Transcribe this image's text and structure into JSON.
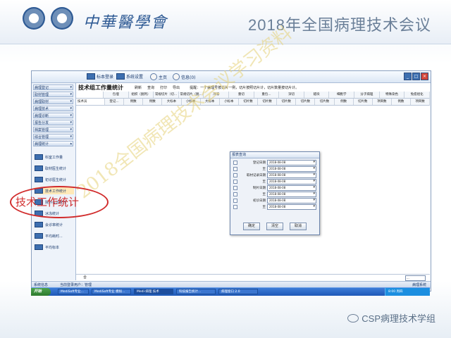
{
  "header": {
    "calligraphy": "中華醫學會",
    "conference_title": "2018年全国病理技术会议"
  },
  "toolbar": {
    "items": [
      {
        "label": "标本登录"
      },
      {
        "label": "系统设置"
      },
      {
        "label": "主页"
      },
      {
        "label": "信息(0)"
      }
    ]
  },
  "sidebar": {
    "groups": [
      {
        "label": "病理登记",
        "arrow": "▾"
      },
      {
        "label": "取材管理",
        "arrow": "▾"
      },
      {
        "label": "病理取材",
        "arrow": "▾"
      },
      {
        "label": "病理技术",
        "arrow": "▾"
      },
      {
        "label": "病理诊断",
        "arrow": "▾"
      },
      {
        "label": "报告分发",
        "arrow": "▾"
      },
      {
        "label": "档案管理",
        "arrow": "▾"
      },
      {
        "label": "综合管理",
        "arrow": "▾"
      },
      {
        "label": "病理统计",
        "arrow": "▴"
      }
    ],
    "sub_items": [
      {
        "label": "科室工作量"
      },
      {
        "label": "取材医生统计"
      },
      {
        "label": "初诊医生统计"
      },
      {
        "label": "技术工作统计"
      },
      {
        "label": "院外会诊统计"
      },
      {
        "label": "冰冻统计"
      },
      {
        "label": "会诊率统计"
      },
      {
        "label": "平均耗时..."
      },
      {
        "label": "平均标本"
      }
    ]
  },
  "main": {
    "title": "技术组工作量统计",
    "actions": [
      "刷新",
      "查询",
      "打印",
      "导出"
    ],
    "tip": "提醒：一个病理号按白片一例，切片按照切片计，切片数量按切片计。",
    "header_row1": [
      "",
      "包埋",
      "组织（脱钙）",
      "常规切片（切...",
      "常规切片（脱...",
      "冷冻",
      "重切",
      "重包...",
      "深切",
      "蜡块",
      "细胞学",
      "分子病理",
      "特殊染色",
      "免疫组化"
    ],
    "header_row2": [
      "技术员",
      "登记...",
      "例数",
      "例数",
      "大标本",
      "小标本",
      "大标本",
      "小标本",
      "切片数",
      "切片数",
      "切片数",
      "切片数",
      "切片数",
      "例数",
      "切片数",
      "项目数",
      "例数",
      "项目数"
    ],
    "bottom_label": "合",
    "bottom_control": "..."
  },
  "dialog": {
    "title": "报表查询",
    "rows": [
      {
        "label": "登记日期",
        "value": "2018-08-08"
      },
      {
        "label": "至",
        "value": "2018-08-08"
      },
      {
        "label": "取材记录日期",
        "value": "2018-08-08"
      },
      {
        "label": "至",
        "value": "2018-08-08"
      },
      {
        "label": "制片日期",
        "value": "2018-08-08"
      },
      {
        "label": "至",
        "value": "2018-08-08"
      },
      {
        "label": "初诊日期",
        "value": "2018-08-08"
      },
      {
        "label": "至",
        "value": "2018-08-08"
      }
    ],
    "buttons": {
      "ok": "确定",
      "clear": "清空",
      "cancel": "取消"
    }
  },
  "status": {
    "left": "系统信息",
    "user": "当前登录用户：管理",
    "right": "病理系统"
  },
  "taskbar": {
    "start": "开始",
    "items": [
      "MediSoft专业...",
      "MediSoft专业 模拟...",
      "Medi-病理 技术",
      "科技报告统计...",
      "病理窗口 2.0"
    ],
    "tray": "8:00 周四"
  },
  "callout": {
    "text": "技术工作统计"
  },
  "watermark": {
    "text": "2018全国病理技术会议学习资料"
  },
  "footer": {
    "credit": "CSP病理技术学组"
  }
}
